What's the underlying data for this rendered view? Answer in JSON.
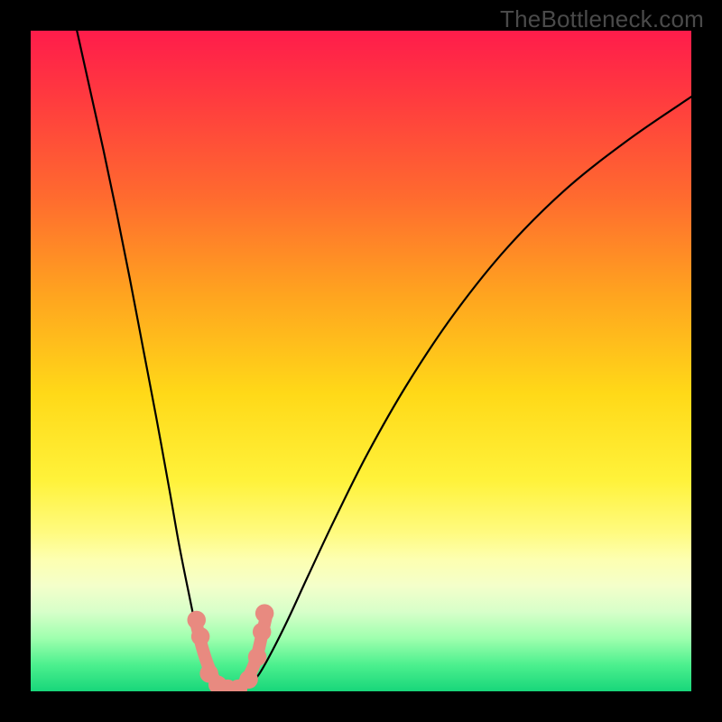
{
  "watermark": "TheBottleneck.com",
  "chart_data": {
    "type": "line",
    "title": "",
    "xlabel": "",
    "ylabel": "",
    "xlim": [
      0,
      1
    ],
    "ylim": [
      0,
      1
    ],
    "gradient_stops": [
      {
        "offset": 0.0,
        "color": "#ff1c4b"
      },
      {
        "offset": 0.1,
        "color": "#ff3a3f"
      },
      {
        "offset": 0.25,
        "color": "#ff6a2f"
      },
      {
        "offset": 0.4,
        "color": "#ffa41f"
      },
      {
        "offset": 0.55,
        "color": "#ffd918"
      },
      {
        "offset": 0.68,
        "color": "#fff23a"
      },
      {
        "offset": 0.76,
        "color": "#fffb80"
      },
      {
        "offset": 0.8,
        "color": "#fdffb0"
      },
      {
        "offset": 0.84,
        "color": "#f4ffca"
      },
      {
        "offset": 0.88,
        "color": "#d7ffc9"
      },
      {
        "offset": 0.92,
        "color": "#9effae"
      },
      {
        "offset": 0.96,
        "color": "#4cf08e"
      },
      {
        "offset": 1.0,
        "color": "#18d67a"
      }
    ],
    "series": [
      {
        "name": "left-curve",
        "color": "#000000",
        "x": [
          0.07,
          0.09,
          0.11,
          0.13,
          0.15,
          0.17,
          0.19,
          0.21,
          0.225,
          0.24,
          0.252,
          0.262,
          0.272,
          0.28
        ],
        "y": [
          1.0,
          0.91,
          0.82,
          0.725,
          0.625,
          0.52,
          0.415,
          0.305,
          0.22,
          0.145,
          0.088,
          0.05,
          0.025,
          0.01
        ]
      },
      {
        "name": "right-curve",
        "color": "#000000",
        "x": [
          0.33,
          0.345,
          0.365,
          0.39,
          0.42,
          0.46,
          0.51,
          0.57,
          0.64,
          0.72,
          0.81,
          0.905,
          1.0
        ],
        "y": [
          0.01,
          0.025,
          0.06,
          0.11,
          0.175,
          0.26,
          0.36,
          0.465,
          0.57,
          0.67,
          0.76,
          0.835,
          0.9
        ]
      },
      {
        "name": "floor-accent",
        "color": "#e88a80",
        "x": [
          0.25,
          0.26,
          0.27,
          0.28,
          0.295,
          0.31,
          0.325,
          0.34,
          0.35,
          0.358
        ],
        "y": [
          0.105,
          0.065,
          0.035,
          0.015,
          0.005,
          0.005,
          0.015,
          0.045,
          0.085,
          0.12
        ]
      }
    ],
    "accent_dots": {
      "color": "#e88a80",
      "r": 0.014,
      "points": [
        {
          "x": 0.251,
          "y": 0.108
        },
        {
          "x": 0.257,
          "y": 0.083
        },
        {
          "x": 0.27,
          "y": 0.027
        },
        {
          "x": 0.283,
          "y": 0.01
        },
        {
          "x": 0.298,
          "y": 0.004
        },
        {
          "x": 0.314,
          "y": 0.004
        },
        {
          "x": 0.33,
          "y": 0.018
        },
        {
          "x": 0.343,
          "y": 0.052
        },
        {
          "x": 0.35,
          "y": 0.09
        },
        {
          "x": 0.354,
          "y": 0.118
        }
      ]
    }
  }
}
